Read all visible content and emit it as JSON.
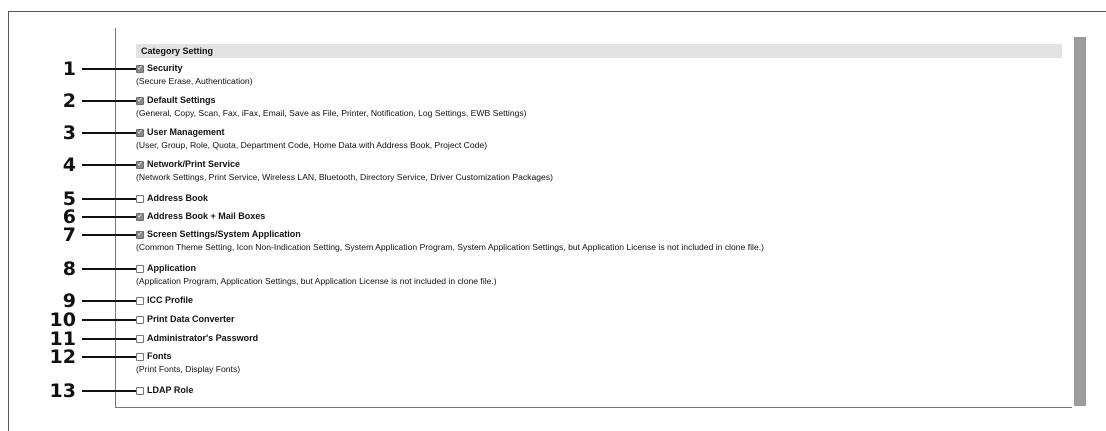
{
  "section_title": "Category Setting",
  "items": [
    {
      "callout": "1",
      "label": "Security",
      "checked": true,
      "description": "(Secure Erase, Authentication)"
    },
    {
      "callout": "2",
      "label": "Default Settings",
      "checked": true,
      "description": "(General, Copy, Scan, Fax, iFax, Email, Save as File, Printer, Notification, Log Settings, EWB Settings)"
    },
    {
      "callout": "3",
      "label": "User Management",
      "checked": true,
      "description": "(User, Group, Role, Quota, Department Code, Home Data with Address Book, Project Code)"
    },
    {
      "callout": "4",
      "label": "Network/Print Service",
      "checked": true,
      "description": "(Network Settings, Print Service, Wireless LAN, Bluetooth, Directory Service, Driver Customization Packages)"
    },
    {
      "callout": "5",
      "label": "Address Book",
      "checked": false,
      "description": ""
    },
    {
      "callout": "6",
      "label": "Address Book + Mail Boxes",
      "checked": true,
      "description": ""
    },
    {
      "callout": "7",
      "label": "Screen Settings/System Application",
      "checked": true,
      "description": "(Common Theme Setting, Icon Non-Indication Setting, System Application Program, System Application Settings, but Application License is not included in clone file.)"
    },
    {
      "callout": "8",
      "label": "Application",
      "checked": false,
      "description": "(Application Program, Application Settings, but Application License is not included in clone file.)"
    },
    {
      "callout": "9",
      "label": "ICC Profile",
      "checked": false,
      "description": ""
    },
    {
      "callout": "10",
      "label": "Print Data Converter",
      "checked": false,
      "description": ""
    },
    {
      "callout": "11",
      "label": "Administrator's Password",
      "checked": false,
      "description": ""
    },
    {
      "callout": "12",
      "label": "Fonts",
      "checked": false,
      "description": "(Print Fonts, Display Fonts)"
    },
    {
      "callout": "13",
      "label": "LDAP Role",
      "checked": false,
      "description": ""
    }
  ]
}
